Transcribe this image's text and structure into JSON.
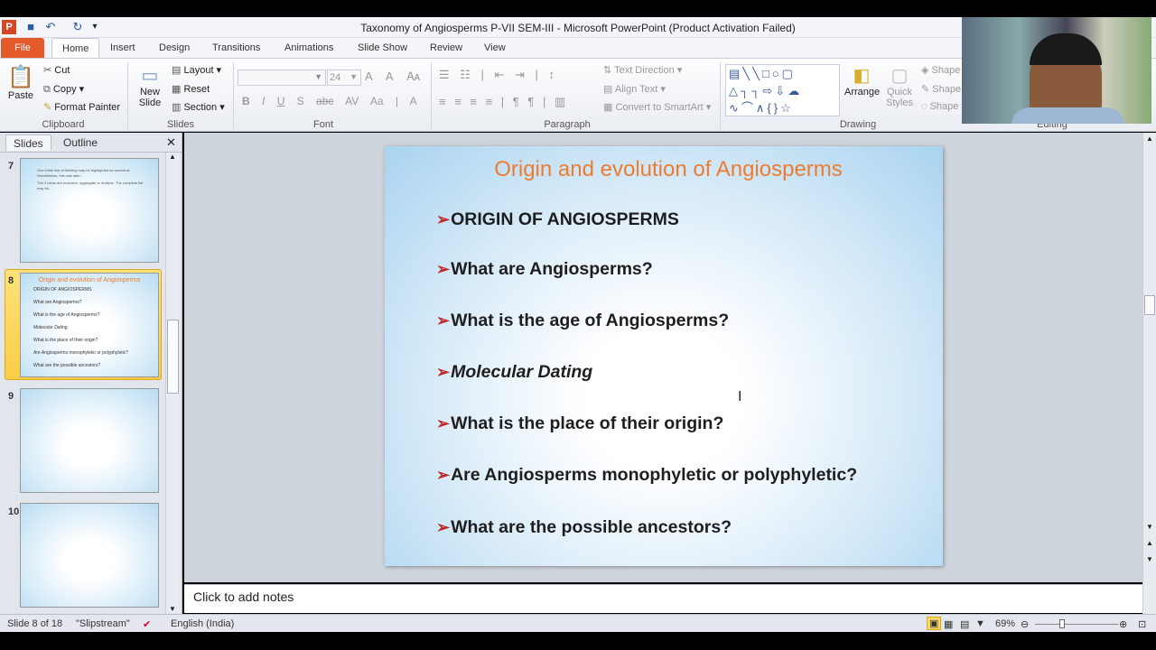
{
  "window": {
    "title": "Taxonomy of Angiosperms P-VII SEM-III  -  Microsoft PowerPoint (Product Activation Failed)"
  },
  "quick_access": [
    "app-icon",
    "save-icon",
    "undo-icon",
    "redo-icon",
    "customize-icon"
  ],
  "tabs": [
    {
      "label": "File"
    },
    {
      "label": "Home"
    },
    {
      "label": "Insert"
    },
    {
      "label": "Design"
    },
    {
      "label": "Transitions"
    },
    {
      "label": "Animations"
    },
    {
      "label": "Slide Show"
    },
    {
      "label": "Review"
    },
    {
      "label": "View"
    }
  ],
  "ribbon": {
    "clipboard": {
      "label": "Clipboard",
      "paste": "Paste",
      "cut": "Cut",
      "copy": "Copy",
      "format_painter": "Format Painter"
    },
    "slides": {
      "label": "Slides",
      "new_slide": "New Slide",
      "layout": "Layout",
      "reset": "Reset",
      "section": "Section"
    },
    "font": {
      "label": "Font",
      "font_name": "",
      "font_size": "24"
    },
    "paragraph": {
      "label": "Paragraph",
      "text_direction": "Text Direction",
      "align_text": "Align Text",
      "convert_smartart": "Convert to SmartArt"
    },
    "drawing": {
      "label": "Drawing",
      "arrange": "Arrange",
      "quick_styles": "Quick Styles",
      "shape_fill": "Shape",
      "shape_outline": "Shape",
      "shape_effects": "Shape"
    },
    "editing": {
      "label": "Editing"
    }
  },
  "left_pane": {
    "tabs": [
      "Slides",
      "Outline"
    ],
    "thumbnails": [
      {
        "number": "7",
        "lines": [
          "One initial line of thinking may be highlighted as ancestral; Nonetheless, this was later...",
          "The 3 ideas are evolution, aggregate or multiple. The complete list may be..."
        ]
      },
      {
        "number": "8",
        "title": "Origin and evolution of Angiosperms",
        "lines": [
          "ORIGIN OF ANGIOSPERMS",
          "What are Angiosperms?",
          "What is the age of Angiosperms?",
          "Molecular Dating",
          "What is the place of their origin?",
          "Are Angiosperms monophyletic or polyphyletic?",
          "What are the possible ancestors?"
        ]
      },
      {
        "number": "9"
      },
      {
        "number": "10"
      }
    ]
  },
  "slide": {
    "title": "Origin and evolution of Angiosperms",
    "title_color": "#ec7c30",
    "bullets": [
      {
        "text": "ORIGIN OF ANGIOSPERMS",
        "italic": false
      },
      {
        "text": "What are Angiosperms?",
        "italic": false
      },
      {
        "text": "What is the age of Angiosperms?",
        "italic": false
      },
      {
        "text": "Molecular Dating",
        "italic": true
      },
      {
        "text": "What is the place of their origin?",
        "italic": false
      },
      {
        "text": "Are Angiosperms monophyletic or polyphyletic?",
        "italic": false
      },
      {
        "text": "What are the possible ancestors?",
        "italic": false
      }
    ]
  },
  "notes": {
    "placeholder": "Click to add notes"
  },
  "status": {
    "slide": "Slide 8 of 18",
    "theme": "\"Slipstream\"",
    "language": "English (India)",
    "zoom": "69%",
    "zoom_percent": 69
  }
}
